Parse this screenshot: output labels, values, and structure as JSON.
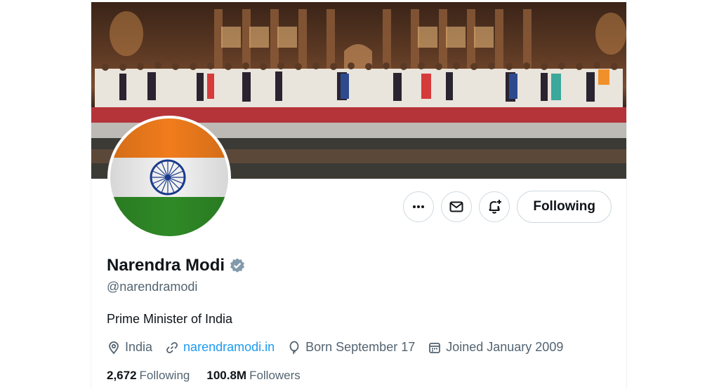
{
  "profile": {
    "name": "Narendra Modi",
    "handle": "@narendramodi",
    "bio": "Prime Minister of India",
    "verified_color": "#829aab"
  },
  "actions": {
    "more_icon": "more-icon",
    "message_icon": "envelope-icon",
    "notify_icon": "bell-plus-icon",
    "following_label": "Following"
  },
  "meta": {
    "location": "India",
    "website": "narendramodi.in",
    "birthday": "Born September 17",
    "joined": "Joined January 2009"
  },
  "stats": {
    "following_count": "2,672",
    "following_label": "Following",
    "followers_count": "100.8M",
    "followers_label": "Followers"
  },
  "colors": {
    "link": "#1d9bf0",
    "secondary_text": "#536471",
    "flag_saffron": "#f07c1c",
    "flag_green": "#2f8a26",
    "flag_chakra": "#1b3a8c"
  }
}
